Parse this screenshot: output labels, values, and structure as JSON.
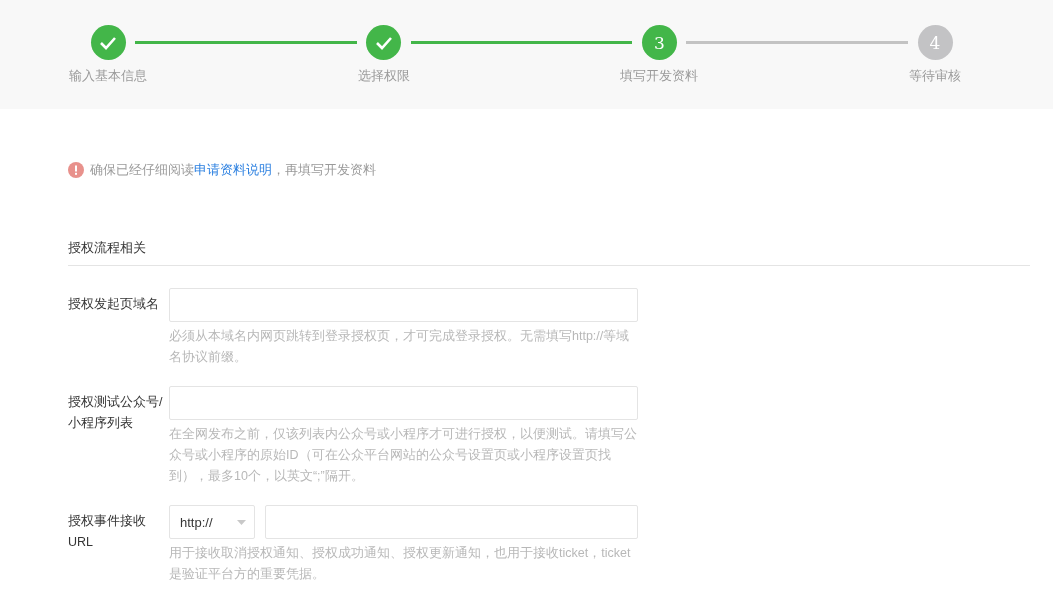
{
  "steps": [
    {
      "label": "输入基本信息",
      "done": true,
      "active": false
    },
    {
      "label": "选择权限",
      "done": true,
      "active": false
    },
    {
      "label": "填写开发资料",
      "done": false,
      "active": true,
      "number": "3"
    },
    {
      "label": "等待审核",
      "done": false,
      "active": false,
      "number": "4"
    }
  ],
  "notice": {
    "before": "确保已经仔细阅读",
    "link": "申请资料说明",
    "after": "，再填写开发资料"
  },
  "section": {
    "title": "授权流程相关"
  },
  "fields": [
    {
      "kind": "text",
      "label": "授权发起页域名",
      "hint": "必须从本域名内网页跳转到登录授权页，才可完成登录授权。无需填写http://等域名协议前缀。"
    },
    {
      "kind": "text",
      "label": "授权测试公众号/小程序列表",
      "hint": "在全网发布之前，仅该列表内公众号或小程序才可进行授权，以便测试。请填写公众号或小程序的原始ID（可在公众平台网站的公众号设置页或小程序设置页找到），最多10个，以英文“;”隔开。"
    },
    {
      "kind": "url",
      "label": "授权事件接收URL",
      "scheme": "http://",
      "hint": "用于接收取消授权通知、授权成功通知、授权更新通知，也用于接收ticket，ticket是验证平台方的重要凭据。"
    }
  ]
}
